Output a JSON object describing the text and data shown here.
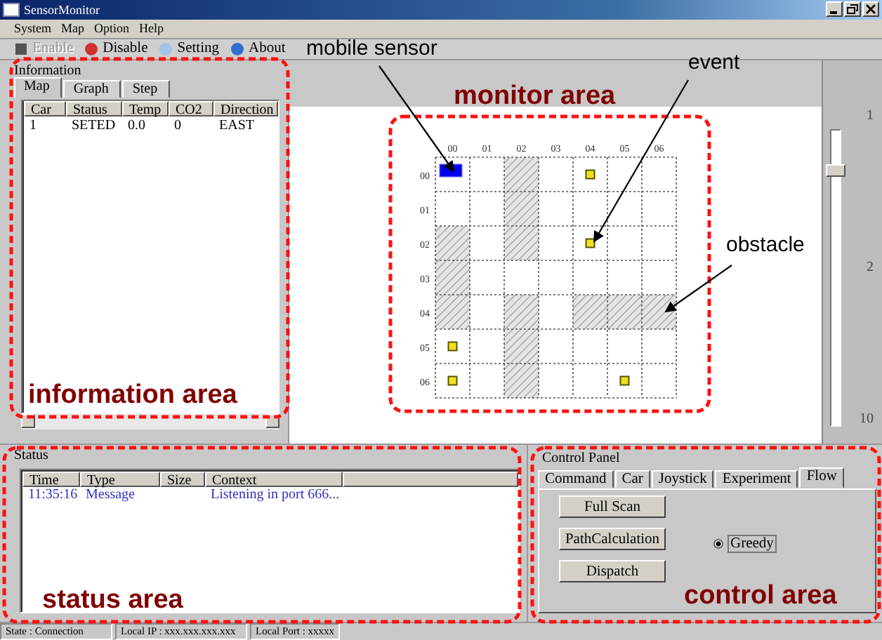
{
  "window": {
    "title": "SensorMonitor"
  },
  "menu": [
    "System",
    "Map",
    "Option",
    "Help"
  ],
  "toolbar": [
    {
      "kind": "enable",
      "label": "Enable",
      "disabled": true
    },
    {
      "kind": "disable",
      "label": "Disable",
      "disabled": false
    },
    {
      "kind": "setting",
      "label": "Setting",
      "disabled": false
    },
    {
      "kind": "about",
      "label": "About",
      "disabled": false
    }
  ],
  "information": {
    "title": "Information",
    "tabs": [
      {
        "label": "Map",
        "selected": true
      },
      {
        "label": "Graph",
        "selected": false
      },
      {
        "label": "Step",
        "selected": false
      }
    ],
    "columns": [
      "Car",
      "Status",
      "Temp",
      "CO2",
      "Direction"
    ],
    "rows": [
      [
        "1",
        "SETED",
        "0.0",
        "0",
        "EAST"
      ]
    ]
  },
  "monitor": {
    "column_labels": [
      "00",
      "01",
      "02",
      "03",
      "04",
      "05",
      "06"
    ],
    "row_labels": [
      "00",
      "01",
      "02",
      "03",
      "04",
      "05",
      "06"
    ],
    "cells": [
      [
        {
          "kind": "sensor"
        },
        {
          "kind": "empty"
        },
        {
          "kind": "obstacle"
        },
        {
          "kind": "empty"
        },
        {
          "kind": "event"
        },
        {
          "kind": "empty"
        },
        {
          "kind": "empty"
        }
      ],
      [
        {
          "kind": "empty"
        },
        {
          "kind": "empty"
        },
        {
          "kind": "obstacle"
        },
        {
          "kind": "empty"
        },
        {
          "kind": "empty"
        },
        {
          "kind": "empty"
        },
        {
          "kind": "empty"
        }
      ],
      [
        {
          "kind": "obstacle"
        },
        {
          "kind": "empty"
        },
        {
          "kind": "obstacle"
        },
        {
          "kind": "empty"
        },
        {
          "kind": "event"
        },
        {
          "kind": "empty"
        },
        {
          "kind": "empty"
        }
      ],
      [
        {
          "kind": "obstacle"
        },
        {
          "kind": "empty"
        },
        {
          "kind": "empty"
        },
        {
          "kind": "empty"
        },
        {
          "kind": "empty"
        },
        {
          "kind": "empty"
        },
        {
          "kind": "empty"
        }
      ],
      [
        {
          "kind": "obstacle"
        },
        {
          "kind": "empty"
        },
        {
          "kind": "obstacle"
        },
        {
          "kind": "empty"
        },
        {
          "kind": "obstacle"
        },
        {
          "kind": "obstacle"
        },
        {
          "kind": "obstacle"
        }
      ],
      [
        {
          "kind": "event"
        },
        {
          "kind": "empty"
        },
        {
          "kind": "obstacle"
        },
        {
          "kind": "empty"
        },
        {
          "kind": "empty"
        },
        {
          "kind": "empty"
        },
        {
          "kind": "empty"
        }
      ],
      [
        {
          "kind": "event"
        },
        {
          "kind": "empty"
        },
        {
          "kind": "obstacle"
        },
        {
          "kind": "empty"
        },
        {
          "kind": "empty"
        },
        {
          "kind": "event"
        },
        {
          "kind": "empty"
        }
      ]
    ]
  },
  "zoom_slider": {
    "labels": [
      "1",
      "2",
      "10"
    ]
  },
  "status": {
    "title": "Status",
    "columns": [
      "Time",
      "Type",
      "Size",
      "Context"
    ],
    "rows": [
      {
        "time": "11:35:16",
        "type": "Message",
        "context": "Listening in port 666..."
      }
    ]
  },
  "control_panel": {
    "title": "Control Panel",
    "tabs": [
      {
        "label": "Command",
        "selected": false
      },
      {
        "label": "Car",
        "selected": false
      },
      {
        "label": "Joystick",
        "selected": false
      },
      {
        "label": "Experiment",
        "selected": false
      },
      {
        "label": "Flow",
        "selected": true
      }
    ],
    "buttons": [
      "Full Scan",
      "PathCalculation",
      "Dispatch"
    ],
    "options": [
      {
        "label": "Greedy",
        "selected": true
      }
    ]
  },
  "status_bar": [
    "State : Connection",
    "Local IP : xxx.xxx.xxx.xxx",
    "Local Port : xxxxx"
  ],
  "annotations": [
    {
      "kind": "region",
      "label": "information area"
    },
    {
      "kind": "region",
      "label": "monitor area"
    },
    {
      "kind": "region",
      "label": "status area"
    },
    {
      "kind": "region",
      "label": "control area"
    },
    {
      "kind": "callout",
      "label": "mobile sensor"
    },
    {
      "kind": "callout",
      "label": "event"
    },
    {
      "kind": "callout",
      "label": "obstacle"
    }
  ]
}
